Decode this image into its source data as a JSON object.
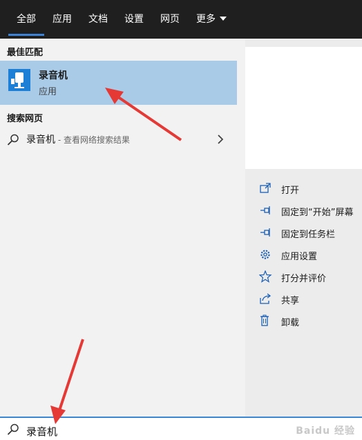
{
  "tabs": [
    {
      "label": "全部",
      "active": true
    },
    {
      "label": "应用"
    },
    {
      "label": "文档"
    },
    {
      "label": "设置"
    },
    {
      "label": "网页"
    },
    {
      "label": "更多"
    }
  ],
  "sections": {
    "best_match": "最佳匹配",
    "web_search": "搜索网页"
  },
  "best_match_item": {
    "name": "录音机",
    "type": "应用",
    "icon": "microphone-app-icon"
  },
  "web_result": {
    "query": "录音机",
    "hint": " - 查看网络搜索结果"
  },
  "actions": [
    {
      "label": "打开",
      "icon": "open-icon"
    },
    {
      "label": "固定到“开始”屏幕",
      "icon": "pin-icon"
    },
    {
      "label": "固定到任务栏",
      "icon": "pin-icon"
    },
    {
      "label": "应用设置",
      "icon": "gear-icon"
    },
    {
      "label": "打分并评价",
      "icon": "star-icon"
    },
    {
      "label": "共享",
      "icon": "share-icon"
    },
    {
      "label": "卸载",
      "icon": "trash-icon"
    }
  ],
  "search": {
    "value": "录音机"
  },
  "colors": {
    "topbar": "#1f1f1f",
    "accent": "#3b82d9",
    "selected": "#a9cbe8",
    "annotation_arrow": "#e53935"
  }
}
